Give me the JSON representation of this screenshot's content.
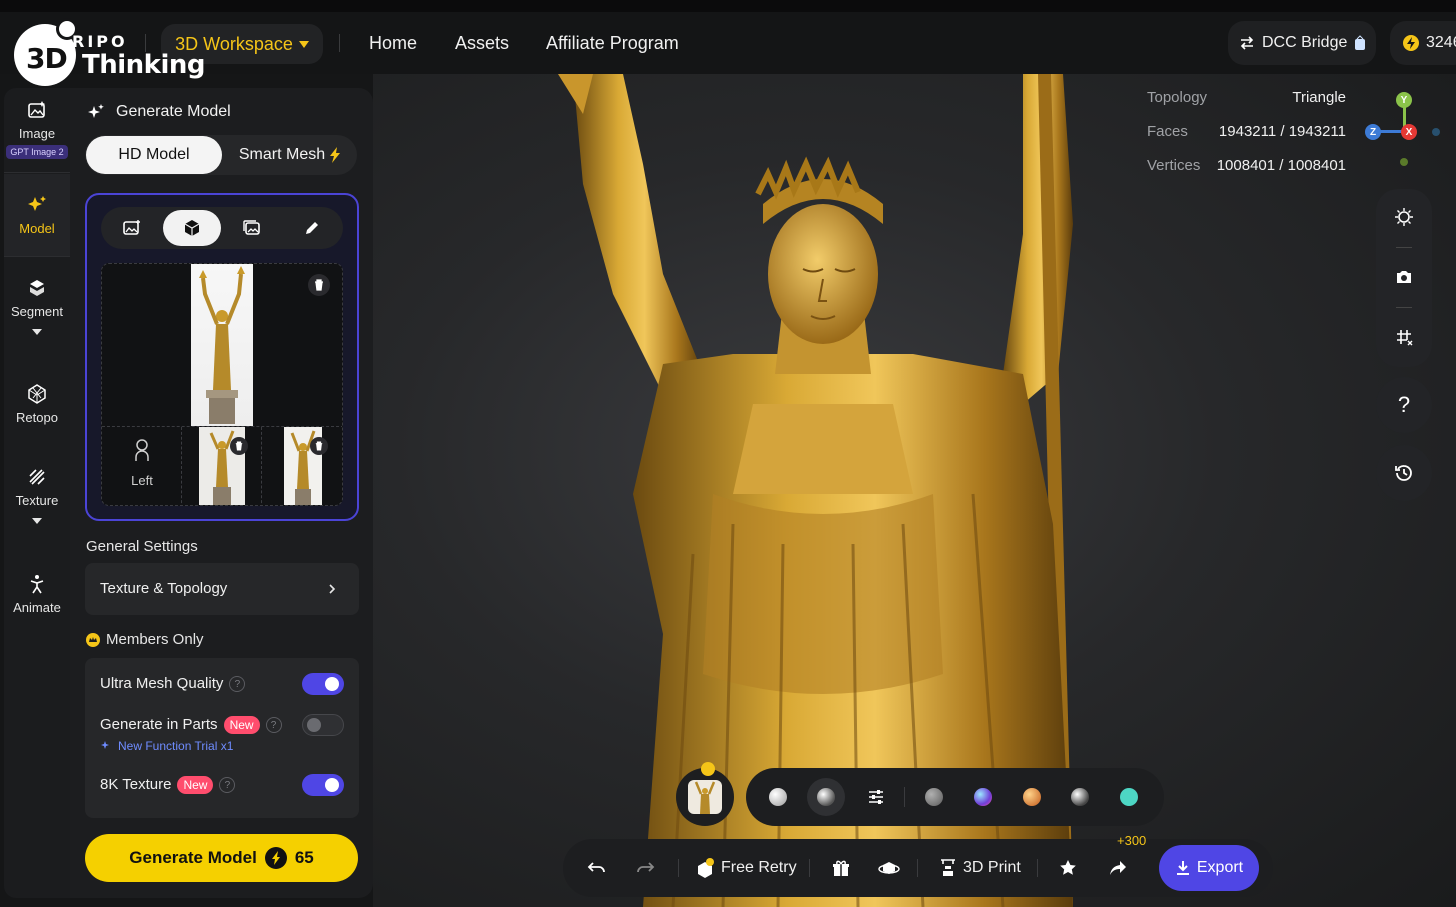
{
  "brand": {
    "logo_mark": "3D",
    "logo_top": "RIPO",
    "logo_bottom": "Thinking"
  },
  "topbar": {
    "workspace_label": "3D Workspace",
    "nav": [
      "Home",
      "Assets",
      "Affiliate Program"
    ],
    "dcc_bridge_label": "DCC Bridge",
    "credits": "3246"
  },
  "rail": {
    "items": [
      {
        "label": "Image",
        "badge": "GPT Image 2"
      },
      {
        "label": "Model"
      },
      {
        "label": "Segment"
      },
      {
        "label": "Retopo"
      },
      {
        "label": "Texture"
      },
      {
        "label": "Animate"
      }
    ]
  },
  "panel": {
    "title": "Generate Model",
    "mode_active": "HD Model",
    "mode_other": "Smart Mesh",
    "view_left_label": "Left",
    "general_settings": "General Settings",
    "texture_topology": "Texture & Topology",
    "members_only": "Members Only",
    "options": [
      {
        "label": "Ultra Mesh Quality",
        "enabled": true
      },
      {
        "label": "Generate in Parts",
        "badge": "New",
        "enabled": false,
        "trial": "New Function Trial x1"
      },
      {
        "label": "8K Texture",
        "badge": "New",
        "enabled": true
      }
    ],
    "generate_button": "Generate Model",
    "generate_cost": "65"
  },
  "viewport": {
    "stats": {
      "topology_label": "Topology",
      "topology_value": "Triangle",
      "faces_label": "Faces",
      "faces_value": "1943211 / 1943211",
      "vertices_label": "Vertices",
      "vertices_value": "1008401 / 1008401"
    },
    "axes": {
      "y": "Y",
      "z": "Z",
      "x": "X"
    },
    "help_glyph": "?"
  },
  "bottom_toolbar": {
    "free_retry": "Free Retry",
    "print": "3D Print",
    "share_bonus": "+300",
    "export": "Export"
  },
  "colors": {
    "accent": "#4f46e5",
    "workspace_gold": "#f5c518",
    "generate_yellow": "#f5d000",
    "new_badge": "#ff4d6d",
    "statue_gold": "#c99a2a"
  }
}
